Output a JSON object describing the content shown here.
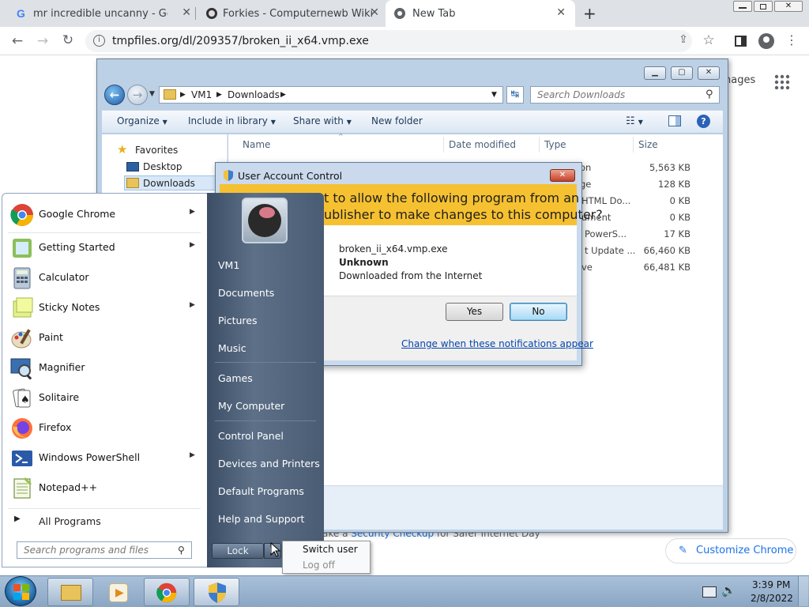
{
  "browser": {
    "tabs": [
      {
        "title": "mr incredible uncanny - Google",
        "active": false
      },
      {
        "title": "Forkies - Computernewb Wiki",
        "active": false
      },
      {
        "title": "New Tab",
        "active": true
      }
    ],
    "new_tab_label": "+",
    "url": "tmpfiles.org/dl/209357/broken_ii_x64.vmp.exe",
    "ntp_images_text": "nages",
    "ntp_footer_text": "ake a ",
    "ntp_footer_link": "Security Checkup",
    "ntp_footer_tail": " for Safer Internet Day",
    "customize_label": "Customize Chrome"
  },
  "explorer": {
    "breadcrumb": [
      "VM1",
      "Downloads"
    ],
    "search_placeholder": "Search Downloads",
    "commands": [
      "Organize",
      "Include in library",
      "Share with",
      "New folder"
    ],
    "nav": {
      "favorites": "Favorites",
      "items": [
        "Desktop",
        "Downloads"
      ]
    },
    "columns": [
      "Name",
      "Date modified",
      "Type",
      "Size"
    ],
    "rows": [
      {
        "type": "on",
        "size": "5,563 KB"
      },
      {
        "type": "ge",
        "size": "128 KB"
      },
      {
        "type": "HTML Do...",
        "size": "0 KB"
      },
      {
        "type": "ument",
        "size": "0 KB"
      },
      {
        "type": "PowerS...",
        "size": "17 KB"
      },
      {
        "type": "t Update ...",
        "size": "66,460 KB"
      },
      {
        "type": "ve",
        "size": "66,481 KB"
      }
    ]
  },
  "uac": {
    "title": "User Account Control",
    "question_line1": "t to allow the following program from an",
    "question_line2": "ublisher to make changes to this computer?",
    "program": "broken_ii_x64.vmp.exe",
    "publisher": "Unknown",
    "origin": "Downloaded from the Internet",
    "yes": "Yes",
    "no": "No",
    "change_link": "Change when these notifications appear"
  },
  "startmenu": {
    "programs": [
      {
        "label": "Google Chrome",
        "arrow": true,
        "icon": "chrome-icon"
      },
      {
        "label": "Getting Started",
        "arrow": true,
        "icon": "getting-started-icon"
      },
      {
        "label": "Calculator",
        "arrow": false,
        "icon": "calculator-icon"
      },
      {
        "label": "Sticky Notes",
        "arrow": true,
        "icon": "sticky-notes-icon"
      },
      {
        "label": "Paint",
        "arrow": false,
        "icon": "paint-icon"
      },
      {
        "label": "Magnifier",
        "arrow": false,
        "icon": "magnifier-icon"
      },
      {
        "label": "Solitaire",
        "arrow": false,
        "icon": "solitaire-icon"
      },
      {
        "label": "Firefox",
        "arrow": false,
        "icon": "firefox-icon"
      },
      {
        "label": "Windows PowerShell",
        "arrow": true,
        "icon": "powershell-icon"
      },
      {
        "label": "Notepad++",
        "arrow": false,
        "icon": "notepadpp-icon"
      }
    ],
    "all_programs": "All Programs",
    "search_placeholder": "Search programs and files",
    "right_items": [
      "VM1",
      "Documents",
      "Pictures",
      "Music",
      "Games",
      "My Computer",
      "Control Panel",
      "Devices and Printers",
      "Default Programs",
      "Help and Support"
    ],
    "lock": "Lock",
    "submenu": [
      "Switch user",
      "Log off"
    ]
  },
  "taskbar": {
    "time": "3:39 PM",
    "date": "2/8/2022"
  },
  "colors": {
    "accent_blue": "#1a73e8",
    "uac_yellow": "#f6c131",
    "win_frame": "#bcd0e6"
  }
}
